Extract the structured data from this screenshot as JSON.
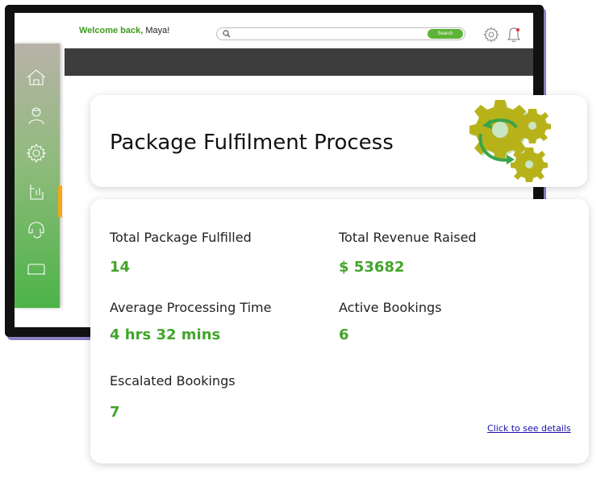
{
  "header": {
    "welcome_prefix": "Welcome back,",
    "user_name": "Maya!",
    "search_placeholder": "",
    "search_button": "Search"
  },
  "title_card": {
    "title": "Package Fulfilment Process"
  },
  "stats": {
    "total_package_label": "Total Package Fulfilled",
    "total_package_value": "14",
    "total_revenue_label": "Total Revenue Raised",
    "total_revenue_value": "$ 53682",
    "avg_time_label": "Average Processing Time",
    "avg_time_value": "4 hrs 32 mins",
    "active_label": "Active Bookings",
    "active_value": "6",
    "escalated_label": "Escalated Bookings",
    "escalated_value": "7",
    "details_link": "Click to see details"
  },
  "sidebar": {
    "items": [
      "home-icon",
      "user-icon",
      "gear-icon",
      "chart-icon",
      "support-icon",
      "screen-icon"
    ],
    "active_index": 4
  },
  "colors": {
    "accent_green": "#42a52b",
    "active_marker": "#f3a81a",
    "dark_band": "#3d3d3d"
  }
}
